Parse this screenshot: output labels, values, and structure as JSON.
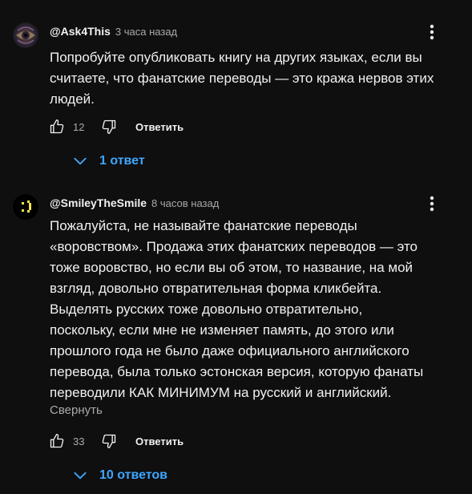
{
  "comments": [
    {
      "author": "@Ask4This",
      "time": "3 часа назад",
      "text_lines": [
        "Попробуйте опубликовать книгу на других языках, если вы",
        "считаете, что фанатские переводы — это кража нервов этих",
        "людей."
      ],
      "likes": "12",
      "reply_label": "Ответить",
      "replies_label": "1 ответ",
      "avatar_icon": "eye-avatar-icon"
    },
    {
      "author": "@SmileyTheSmile",
      "time": "8 часов назад",
      "text_lines": [
        "Пожалуйста, не называйте фанатские переводы",
        "«воровством». Продажа этих фанатских переводов — это",
        "тоже воровство, но если вы об этом, то название, на мой",
        "взгляд, довольно отвратительная форма кликбейта.",
        "Выделять русских тоже довольно отвратительно,",
        "поскольку, если мне не изменяет память, до этого или",
        "прошлого года не было даже официального английского",
        "перевода, была только эстонская версия, которую фанаты",
        "переводили КАК МИНИМУМ на русский и английский."
      ],
      "collapse_label": "Свернуть",
      "likes": "33",
      "reply_label": "Ответить",
      "replies_label": "10 ответов",
      "avatar_icon": "smiley-avatar-icon"
    }
  ],
  "colors": {
    "background": "#0f0f0f",
    "text": "#f1f1f1",
    "secondary": "#aaaaaa",
    "link": "#3ea6ff"
  }
}
